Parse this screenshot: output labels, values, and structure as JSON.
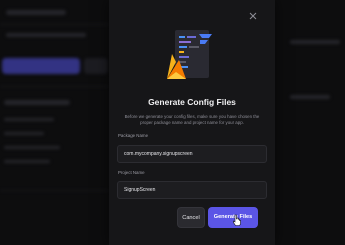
{
  "dialog": {
    "title": "Generate Config Files",
    "description": "Before we generate your config files, make sure you have chosen the proper package name and project name for your app.",
    "package_name": {
      "label": "Package Name",
      "value": "com.mycompany.signupscreen"
    },
    "project_name": {
      "label": "Project Name",
      "value": "SignupScreen"
    },
    "cancel_label": "Cancel",
    "generate_label": "Generate Files"
  },
  "colors": {
    "modal_bg": "#161618",
    "primary": "#5b55e6",
    "firebase_yellow": "#f6b21b",
    "firebase_orange": "#f57c00",
    "accent_blue": "#4a90f5"
  },
  "icons": [
    "close-icon",
    "firebase-logo-icon",
    "code-window-illustration",
    "flutterflow-logo-icon",
    "pointer-cursor-icon"
  ]
}
